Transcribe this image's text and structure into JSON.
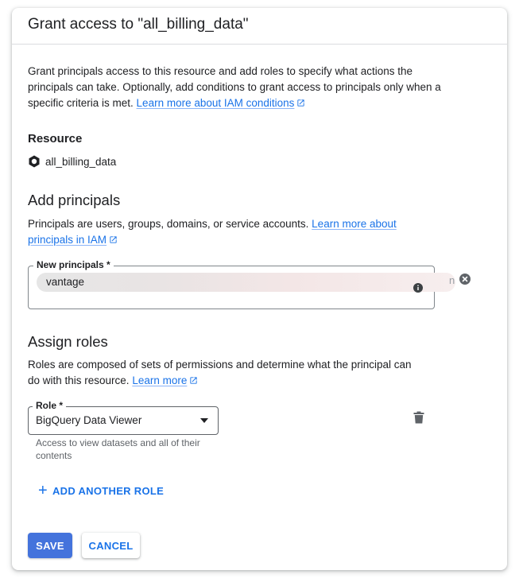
{
  "dialog": {
    "title": "Grant access to \"all_billing_data\""
  },
  "intro": {
    "text": "Grant principals access to this resource and add roles to specify what actions the principals can take. Optionally, add conditions to grant access to principals only when a specific criteria is met.",
    "link": "Learn more about IAM conditions"
  },
  "resource": {
    "heading": "Resource",
    "name": "all_billing_data",
    "icon": "bigquery-dataset-icon"
  },
  "add_principals": {
    "heading": "Add principals",
    "text": "Principals are users, groups, domains, or service accounts.",
    "link": "Learn more about principals in IAM",
    "field_label": "New principals *",
    "chip_value": "vantage",
    "chip_tail": "n"
  },
  "assign_roles": {
    "heading": "Assign roles",
    "text": "Roles are composed of sets of permissions and determine what the principal can do with this resource.",
    "link": "Learn more",
    "role_label": "Role *",
    "role_value": "BigQuery Data Viewer",
    "role_helper": "Access to view datasets and all of their contents",
    "add_another": "ADD ANOTHER ROLE"
  },
  "actions": {
    "save": "SAVE",
    "cancel": "CANCEL"
  },
  "colors": {
    "primary": "#4473dc",
    "link": "#1a73e8",
    "text": "#202124",
    "muted": "#5f6368"
  }
}
